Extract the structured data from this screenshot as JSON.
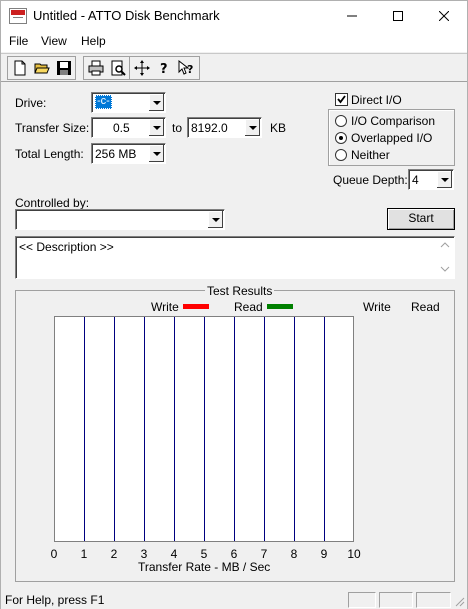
{
  "window": {
    "title": "Untitled - ATTO Disk Benchmark",
    "controls": [
      "minimize-icon",
      "maximize-icon",
      "close-icon"
    ]
  },
  "menu": {
    "items": [
      "File",
      "View",
      "Help"
    ]
  },
  "toolbar": {
    "icons": [
      "new-file-icon",
      "open-folder-icon",
      "save-icon",
      "print-icon",
      "print-preview-icon",
      "move-icon",
      "help-icon",
      "context-help-icon"
    ]
  },
  "settings": {
    "drive": {
      "label": "Drive:",
      "value": "-c-"
    },
    "transfer_size": {
      "label": "Transfer Size:",
      "from": "0.5",
      "to_label": "to",
      "to": "8192.0",
      "unit": "KB"
    },
    "total_length": {
      "label": "Total Length:",
      "value": "256 MB"
    },
    "direct_io": {
      "label": "Direct I/O",
      "checked": true
    },
    "io_modes": [
      {
        "label": "I/O Comparison",
        "selected": false
      },
      {
        "label": "Overlapped I/O",
        "selected": true
      },
      {
        "label": "Neither",
        "selected": false
      }
    ],
    "queue_depth": {
      "label": "Queue Depth:",
      "value": "4"
    },
    "controlled_by": {
      "label": "Controlled by:",
      "value": ""
    },
    "start_label": "Start",
    "description": "<< Description >>"
  },
  "results": {
    "title": "Test Results",
    "legend": [
      {
        "label": "Write",
        "color": "#ff0000"
      },
      {
        "label": "Read",
        "color": "#008000"
      }
    ],
    "column_headers": [
      "Write",
      "Read"
    ],
    "x_axis_label": "Transfer Rate - MB / Sec",
    "x_ticks": [
      "0",
      "1",
      "2",
      "3",
      "4",
      "5",
      "6",
      "7",
      "8",
      "9",
      "10"
    ],
    "grid_color": "#000080"
  },
  "status": {
    "text": "For Help, press F1"
  }
}
